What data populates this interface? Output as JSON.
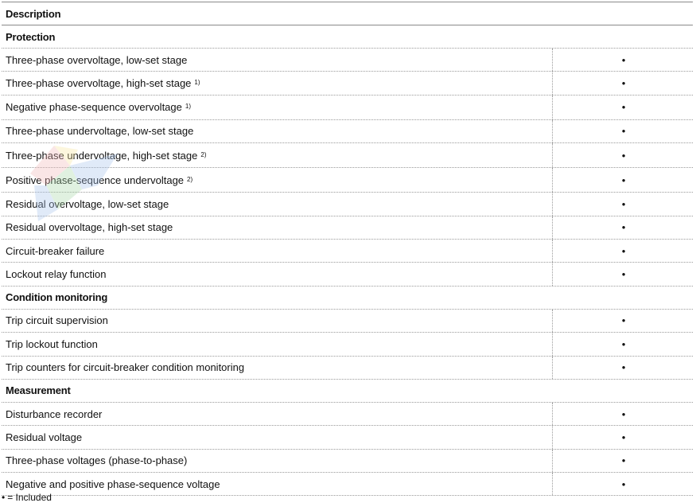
{
  "table": {
    "header": {
      "description": "Description"
    },
    "sections": [
      {
        "title": "Protection",
        "rows": [
          {
            "label": "Three-phase overvoltage, low-set stage",
            "note": "",
            "mark": "•"
          },
          {
            "label": "Three-phase overvoltage, high-set stage",
            "note": "1)",
            "mark": "•"
          },
          {
            "label": "Negative phase-sequence overvoltage",
            "note": "1)",
            "mark": "•"
          },
          {
            "label": "Three-phase undervoltage, low-set stage",
            "note": "",
            "mark": "•"
          },
          {
            "label": "Three-phase undervoltage, high-set stage",
            "note": "2)",
            "mark": "•"
          },
          {
            "label": "Positive phase-sequence undervoltage",
            "note": "2)",
            "mark": "•"
          },
          {
            "label": "Residual overvoltage, low-set stage",
            "note": "",
            "mark": "•"
          },
          {
            "label": "Residual overvoltage, high-set stage",
            "note": "",
            "mark": "•"
          },
          {
            "label": "Circuit-breaker failure",
            "note": "",
            "mark": "•"
          },
          {
            "label": "Lockout relay function",
            "note": "",
            "mark": "•"
          }
        ]
      },
      {
        "title": "Condition monitoring",
        "rows": [
          {
            "label": "Trip circuit supervision",
            "note": "",
            "mark": "•"
          },
          {
            "label": "Trip lockout function",
            "note": "",
            "mark": "•"
          },
          {
            "label": "Trip counters for circuit-breaker condition monitoring",
            "note": "",
            "mark": "•"
          }
        ]
      },
      {
        "title": "Measurement",
        "rows": [
          {
            "label": "Disturbance recorder",
            "note": "",
            "mark": "•"
          },
          {
            "label": "Residual voltage",
            "note": "",
            "mark": "•"
          },
          {
            "label": "Three-phase voltages (phase-to-phase)",
            "note": "",
            "mark": "•"
          },
          {
            "label": "Negative and positive phase-sequence voltage",
            "note": "",
            "mark": "•"
          }
        ]
      }
    ]
  },
  "legend": {
    "symbol": "•",
    "text": "= Included"
  },
  "watermark": {
    "icon": "pinwheel-logo-icon",
    "colors": [
      "#f2b8b8",
      "#f7e6a0",
      "#a8d8a8",
      "#a8c4ec"
    ]
  }
}
